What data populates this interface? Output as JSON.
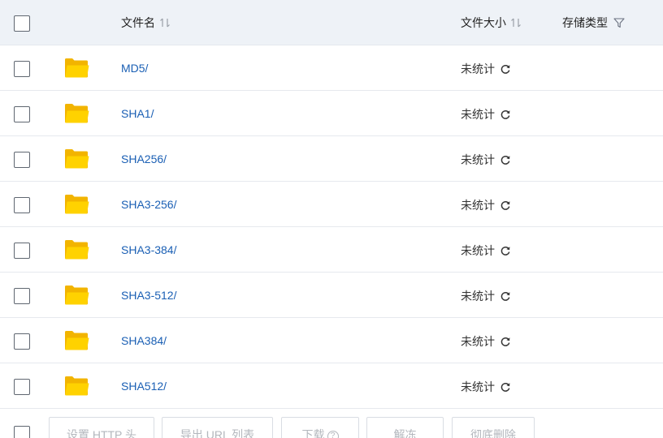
{
  "header": {
    "name_label": "文件名",
    "size_label": "文件大小",
    "type_label": "存储类型"
  },
  "rows": [
    {
      "name": "MD5/",
      "size": "未统计"
    },
    {
      "name": "SHA1/",
      "size": "未统计"
    },
    {
      "name": "SHA256/",
      "size": "未统计"
    },
    {
      "name": "SHA3-256/",
      "size": "未统计"
    },
    {
      "name": "SHA3-384/",
      "size": "未统计"
    },
    {
      "name": "SHA3-512/",
      "size": "未统计"
    },
    {
      "name": "SHA384/",
      "size": "未统计"
    },
    {
      "name": "SHA512/",
      "size": "未统计"
    }
  ],
  "toolbar": {
    "set_http_header": "设置 HTTP 头",
    "export_url_list": "导出 URL 列表",
    "download": "下载",
    "unfreeze": "解冻",
    "delete_permanently": "彻底删除"
  },
  "colors": {
    "header_bg": "#eef2f7",
    "link": "#1a5fb4",
    "folder": "#ffc400",
    "disabled_text": "#b3b7bd"
  },
  "icons": {
    "folder": "folder-icon",
    "refresh": "refresh-icon",
    "sort": "sort-icon",
    "filter": "filter-icon",
    "help": "help-icon"
  }
}
